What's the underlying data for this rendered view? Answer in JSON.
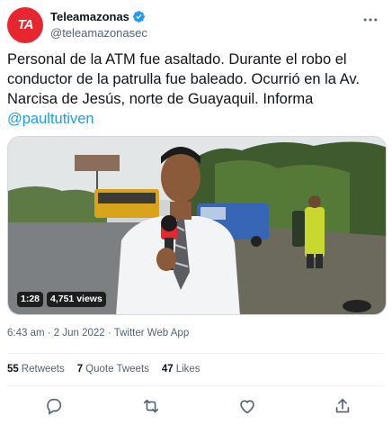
{
  "tweet": {
    "display_name": "Teleamazonas",
    "handle": "@teleamazonasec",
    "avatar_text": "TA",
    "text_main": "Personal de la ATM fue asaltado. Durante el robo el conductor de la patrulla fue baleado. Ocurrió en la Av. Narcisa de Jesús, norte de Guayaquil. Informa",
    "mention": "@paultutiven",
    "timestamp": "6:43 am · 2 Jun 2022 · Twitter Web App"
  },
  "media": {
    "duration": "1:28",
    "views": "4,751 views"
  },
  "stats": [
    {
      "count": "55",
      "label": "Retweets"
    },
    {
      "count": "7",
      "label": "Quote Tweets"
    },
    {
      "count": "47",
      "label": "Likes"
    }
  ],
  "icons": {
    "verified": "verified-badge-icon",
    "more": "more-dots-icon",
    "reply": "reply-icon",
    "retweet": "retweet-icon",
    "like": "like-icon",
    "share": "share-icon"
  },
  "colors": {
    "brand": "#e8262f",
    "link": "#1d9bf0",
    "verified": "#1d9bf0",
    "muted": "#536471"
  }
}
